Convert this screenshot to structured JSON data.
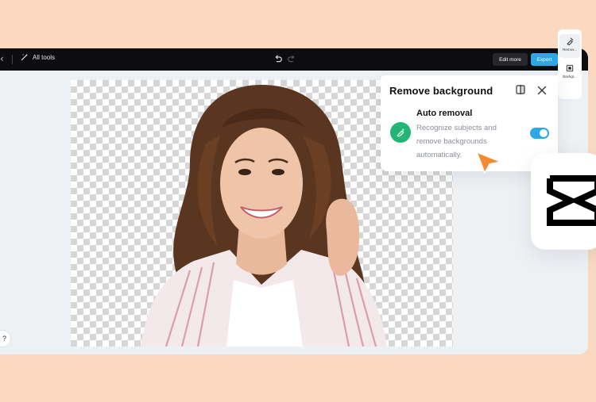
{
  "topbar": {
    "all_tools_label": "All tools",
    "edit_more_label": "Edit more",
    "export_label": "Export"
  },
  "panel": {
    "title": "Remove background",
    "auto_removal": {
      "title": "Auto removal",
      "description": "Recognize subjects and remove backgrounds automatically.",
      "enabled": true
    }
  },
  "side_rail": {
    "items": [
      {
        "label": "Remov...",
        "icon": "eraser-icon",
        "active": true
      },
      {
        "label": "Backgr...",
        "icon": "background-icon",
        "active": false
      }
    ]
  },
  "help": {
    "label": "?"
  },
  "colors": {
    "accent": "#2aa8e8",
    "auto_icon_bg": "#22b573",
    "page_bg": "#fbd9c0",
    "topbar_bg": "#0d0d0f"
  },
  "icons": [
    "chevron-left-icon",
    "magic-wand-icon",
    "undo-icon",
    "redo-icon",
    "compare-icon",
    "close-icon",
    "magic-eraser-icon",
    "cursor-arrow-icon",
    "capcut-logo"
  ]
}
